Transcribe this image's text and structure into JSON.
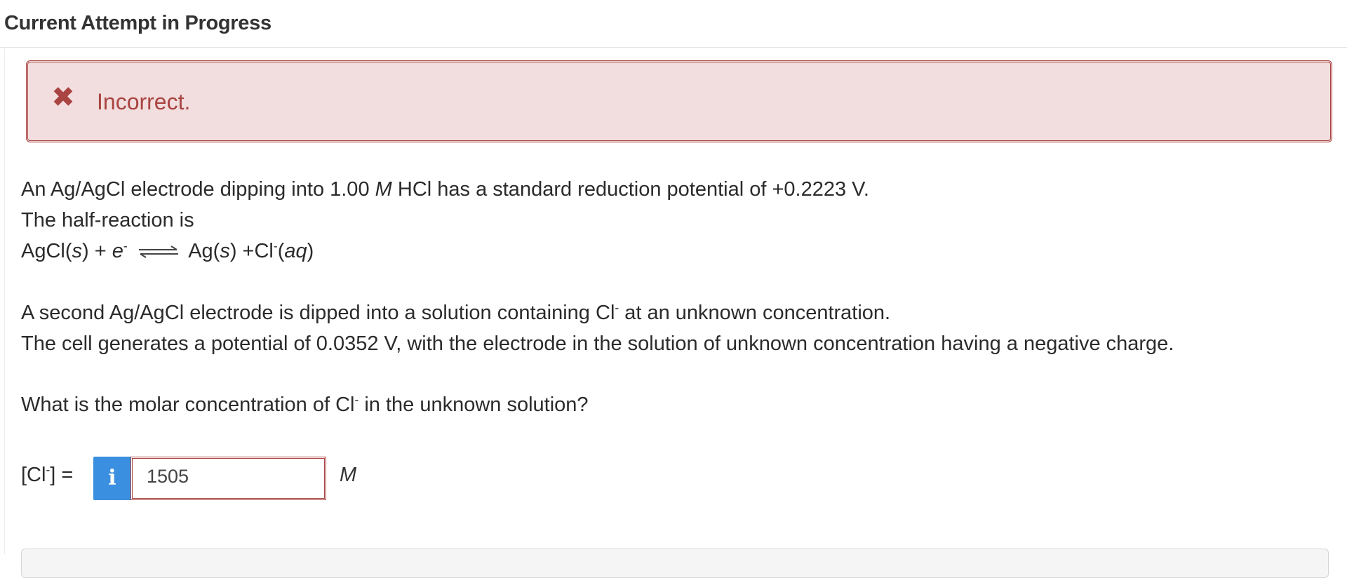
{
  "header": {
    "title": "Current Attempt in Progress"
  },
  "feedback": {
    "status": "Incorrect.",
    "icon": "close-x-icon",
    "color": "#a94442",
    "bg": "#f2dede"
  },
  "question": {
    "line1_a": "An Ag/AgCl electrode dipping into 1.00 ",
    "line1_unit": "M",
    "line1_b": " HCl has a standard reduction potential of +0.2223 V.",
    "line2": "The half-reaction is",
    "reaction": {
      "r1": "AgCl(",
      "r1_state": "s",
      "r1_end": ") + ",
      "r2": "e",
      "r2_charge": "-",
      "p1": "Ag(",
      "p1_state": "s",
      "p1_end": ") +Cl",
      "p2_charge": "-",
      "p2_open": "(",
      "p2_state": "aq",
      "p2_close": ")"
    },
    "para2_line1_a": "A second Ag/AgCl electrode is dipped into a solution containing Cl",
    "para2_line1_charge": "-",
    "para2_line1_b": " at an unknown concentration.",
    "para2_line2": "The cell generates a potential of 0.0352 V, with the electrode in the solution of unknown concentration having a negative charge.",
    "prompt_a": "What is the molar concentration of Cl",
    "prompt_charge": "-",
    "prompt_b": " in the unknown solution?"
  },
  "answer": {
    "label_a": "[Cl",
    "label_charge": "-",
    "label_b": "] =",
    "info_glyph": "i",
    "value": "1505",
    "unit": "M",
    "info_color": "#3b8fe0"
  }
}
